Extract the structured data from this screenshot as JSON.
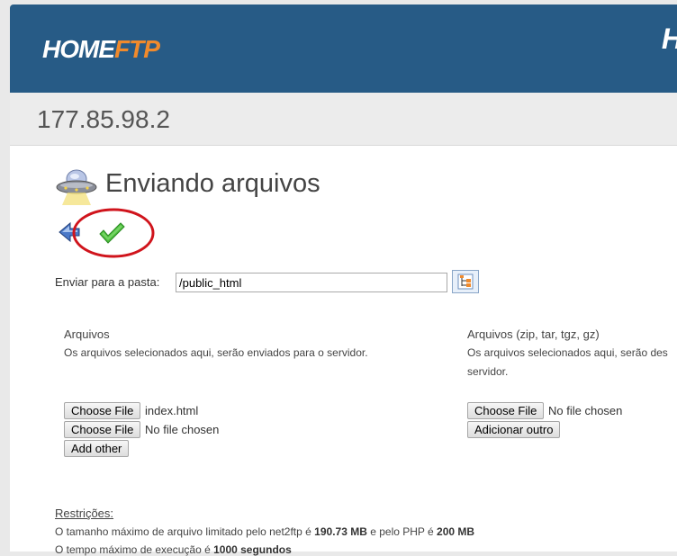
{
  "header": {
    "logo_home": "HOME",
    "logo_ftp": "FTP",
    "logo_right": "H"
  },
  "server": {
    "ip": "177.85.98.2"
  },
  "page": {
    "title": "Enviando arquivos"
  },
  "toolbar": {
    "back_icon": "back-arrow-icon",
    "submit_icon": "checkmark-icon"
  },
  "folder": {
    "label": "Enviar para a pasta:",
    "value": "/public_html",
    "browse_icon": "folder-tree-icon"
  },
  "files": {
    "title": "Arquivos",
    "description": "Os arquivos selecionados aqui, serão enviados para o servidor.",
    "inputs": [
      {
        "button": "Choose File",
        "filename": "index.html"
      },
      {
        "button": "Choose File",
        "filename": "No file chosen"
      }
    ],
    "add_button": "Add other"
  },
  "archives": {
    "title": "Arquivos (zip, tar, tgz, gz)",
    "description_line1": "Os arquivos selecionados aqui, serão des",
    "description_line2": "servidor.",
    "inputs": [
      {
        "button": "Choose File",
        "filename": "No file chosen"
      }
    ],
    "add_button": "Adicionar outro"
  },
  "restrictions": {
    "title": "Restrições:",
    "line1_prefix": "O tamanho máximo de arquivo limitado pelo net2ftp é ",
    "line1_value1": "190.73 MB",
    "line1_mid": " e pelo PHP é ",
    "line1_value2": "200 MB",
    "line2_prefix": "O tempo máximo de execução é ",
    "line2_value": "1000 segundos"
  },
  "colors": {
    "header_bg": "#275b86",
    "logo_accent": "#f08a2c",
    "annotation_circle": "#d0141c"
  }
}
